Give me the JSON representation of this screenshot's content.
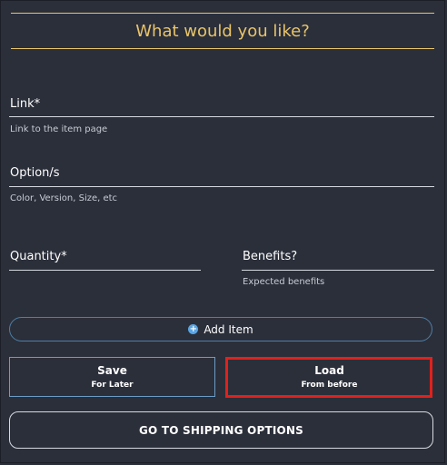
{
  "header": {
    "title": "What would you like?"
  },
  "fields": {
    "link": {
      "label": "Link*",
      "hint": "Link to the item page"
    },
    "options": {
      "label": "Option/s",
      "hint": "Color, Version, Size, etc"
    },
    "quantity": {
      "label": "Quantity*"
    },
    "benefits": {
      "label": "Benefits?",
      "hint": "Expected benefits"
    }
  },
  "buttons": {
    "add_item": "Add Item",
    "add_icon": "plus-circle-icon",
    "save": {
      "label": "Save",
      "sub": "For Later"
    },
    "load": {
      "label": "Load",
      "sub": "From before"
    },
    "shipping": "GO TO SHIPPING OPTIONS"
  },
  "colors": {
    "background": "#2b2f3a",
    "accent": "#e9c46a",
    "highlight": "#e0211d",
    "add_border": "#4e7ea6"
  }
}
